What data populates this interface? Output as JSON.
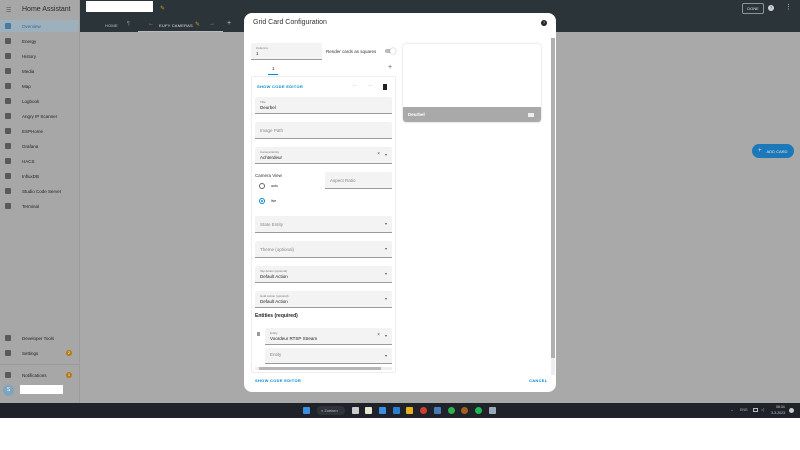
{
  "sidebar": {
    "title": "Home Assistant",
    "items": [
      {
        "label": "Overview",
        "icon": "overview-icon"
      },
      {
        "label": "Energy",
        "icon": "energy-icon"
      },
      {
        "label": "History",
        "icon": "history-icon"
      },
      {
        "label": "Media",
        "icon": "media-icon"
      },
      {
        "label": "Map",
        "icon": "map-icon"
      },
      {
        "label": "Logbook",
        "icon": "logbook-icon"
      },
      {
        "label": "Angry IP Scanner",
        "icon": "angry-ip-icon"
      },
      {
        "label": "ESPHome",
        "icon": "esphome-icon"
      },
      {
        "label": "Grafana",
        "icon": "grafana-icon"
      },
      {
        "label": "HACS",
        "icon": "hacs-icon"
      },
      {
        "label": "InfluxDB",
        "icon": "influxdb-icon"
      },
      {
        "label": "Studio Code Server",
        "icon": "vscode-icon"
      },
      {
        "label": "Terminal",
        "icon": "terminal-icon"
      }
    ],
    "developer_tools": "Developer Tools",
    "settings": "Settings",
    "settings_badge": "2",
    "notifications": "Notifications",
    "notifications_badge": "1",
    "avatar_initial": "S"
  },
  "header": {
    "tabs": [
      "HOME",
      "EUFY CAMERAS"
    ],
    "done": "DONE",
    "add_tab": "+"
  },
  "main": {
    "add_card": "ADD CARD"
  },
  "dialog": {
    "title": "Grid Card Configuration",
    "columns_label": "Columns",
    "columns_value": "1",
    "render_squares": "Render cards as squares",
    "card_tab": "1",
    "show_code_editor": "SHOW CODE EDITOR",
    "title_label": "Title",
    "title_value": "Deurbel",
    "image_path": "Image Path",
    "camera_entity_label": "Camera Entity",
    "camera_entity_value": "Achterdeur",
    "camera_view": "Camera View",
    "aspect_ratio": "Aspect Ratio",
    "view_auto": "auto",
    "view_live": "live",
    "state_entity": "State Entity",
    "theme": "Theme (optional)",
    "tap_label": "Tap Action (optional)",
    "tap_value": "Default Action",
    "hold_label": "Hold Action (optional)",
    "hold_value": "Default Action",
    "entities_heading": "Entities (required)",
    "entity_label": "Entity",
    "entity_value": "Voordeur RTSP Stream",
    "entity_placeholder": "Entity",
    "preview_title": "Deurbel",
    "footer_code": "SHOW CODE EDITOR",
    "cancel": "CANCEL"
  },
  "taskbar": {
    "search": "Zoeken",
    "lang": "ENG",
    "time": "08:34",
    "date": "3-3-2023"
  },
  "colors": {
    "accent": "#0288d1",
    "header": "#2a3439",
    "badge": "#b87a10"
  }
}
